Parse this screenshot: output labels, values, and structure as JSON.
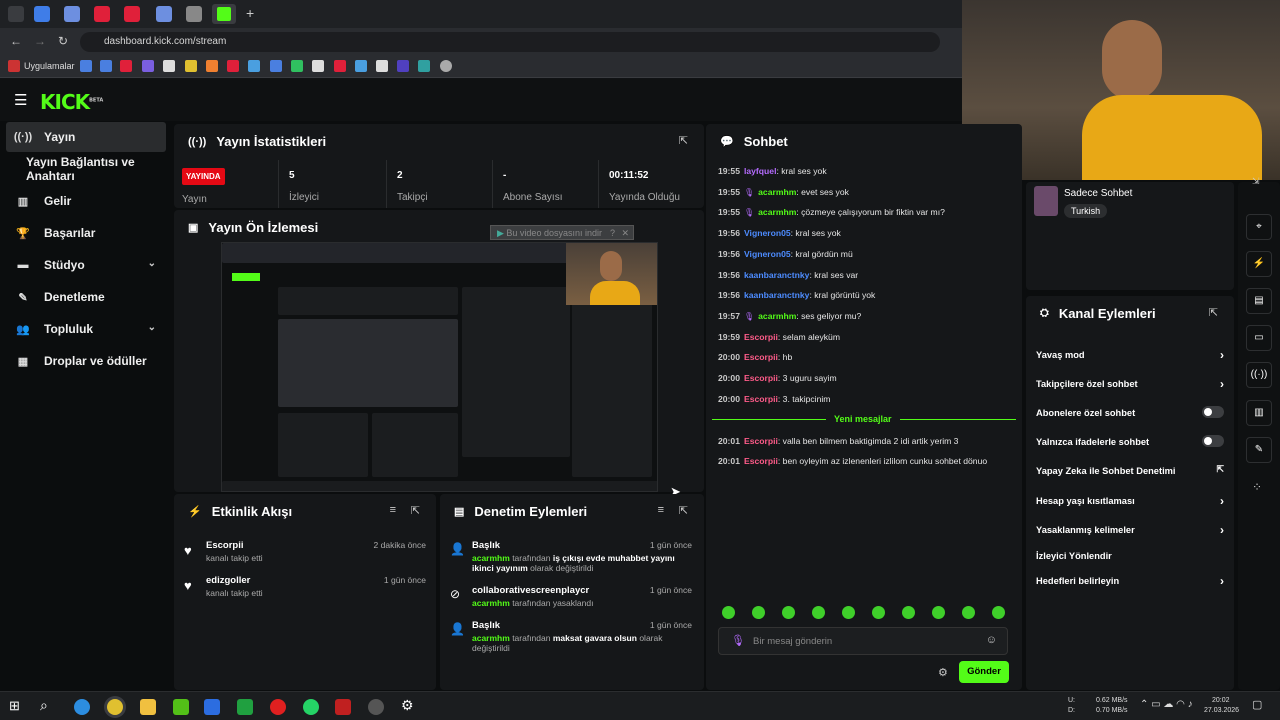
{
  "browser": {
    "url": "dashboard.kick.com/stream",
    "bookmarks_label": "Uygulamalar"
  },
  "app": {
    "logo": "KICK",
    "logo_badge": "BETA"
  },
  "sidebar": [
    {
      "label": "Yayın",
      "icon": "broadcast-icon",
      "active": true
    },
    {
      "label": "Yayın Bağlantısı ve Anahtarı",
      "icon": "",
      "active": false
    },
    {
      "label": "Gelir",
      "icon": "chart-icon",
      "active": false
    },
    {
      "label": "Başarılar",
      "icon": "trophy-icon",
      "active": false
    },
    {
      "label": "Stüdyo",
      "icon": "video-icon",
      "active": false,
      "expandable": true
    },
    {
      "label": "Denetleme",
      "icon": "wrench-icon",
      "active": false
    },
    {
      "label": "Topluluk",
      "icon": "people-icon",
      "active": false,
      "expandable": true
    },
    {
      "label": "Droplar ve ödüller",
      "icon": "gift-icon",
      "active": false
    }
  ],
  "stats": {
    "title": "Yayın İstatistikleri",
    "live_badge": "YAYINDA",
    "live_label": "Yayın",
    "items": [
      {
        "value": "5",
        "label": "İzleyici"
      },
      {
        "value": "2",
        "label": "Takipçi"
      },
      {
        "value": "-",
        "label": "Abone Sayısı"
      },
      {
        "value": "00:11:52",
        "label": "Yayında Olduğu"
      }
    ]
  },
  "preview": {
    "title": "Yayın Ön İzlemesi",
    "download": "Bu video dosyasını indir",
    "help": "?",
    "close": "✕"
  },
  "activity": {
    "title": "Etkinlik Akışı",
    "items": [
      {
        "name": "Escorpii",
        "text": "kanalı takip etti",
        "time": "2 dakika önce"
      },
      {
        "name": "edizgoller",
        "text": "kanalı takip etti",
        "time": "1 gün önce"
      }
    ]
  },
  "moderation": {
    "title": "Denetim Eylemleri",
    "items": [
      {
        "title": "Başlık",
        "user": "acarmhm",
        "mid": "tarafından",
        "bold": "iş çıkışı evde muhabbet yayını ikinci yayınım",
        "tail": "olarak değiştirildi",
        "time": "1 gün önce"
      },
      {
        "title": "collaborativescreenplaycr",
        "user": "acarmhm",
        "mid": "tarafından yasaklandı",
        "bold": "",
        "tail": "",
        "time": "1 gün önce"
      },
      {
        "title": "Başlık",
        "user": "acarmhm",
        "mid": "tarafından",
        "bold": "maksat gavara olsun",
        "tail": "olarak değiştirildi",
        "time": "1 gün önce"
      }
    ]
  },
  "chat": {
    "title": "Sohbet",
    "new_messages": "Yeni mesajlar",
    "placeholder": "Bir mesaj gönderin",
    "send": "Gönder",
    "messages": [
      {
        "time": "19:55",
        "user": "layfquel",
        "text": ": kral ses yok",
        "color": "#b56cff",
        "badge": false
      },
      {
        "time": "19:55",
        "user": "acarmhm",
        "text": ": evet ses yok",
        "color": "#53fc18",
        "badge": true
      },
      {
        "time": "19:55",
        "user": "acarmhm",
        "text": ": çözmeye çalışıyorum bir fiktin var mı?",
        "color": "#53fc18",
        "badge": true
      },
      {
        "time": "19:56",
        "user": "Vigneron05",
        "text": ": kral ses yok",
        "color": "#4d8cff",
        "badge": false
      },
      {
        "time": "19:56",
        "user": "Vigneron05",
        "text": ": kral gördün mü",
        "color": "#4d8cff",
        "badge": false
      },
      {
        "time": "19:56",
        "user": "kaanbaranctnky",
        "text": ": kral ses var",
        "color": "#4d8cff",
        "badge": false
      },
      {
        "time": "19:56",
        "user": "kaanbaranctnky",
        "text": ": kral görüntü yok",
        "color": "#4d8cff",
        "badge": false
      },
      {
        "time": "19:57",
        "user": "acarmhm",
        "text": ": ses geliyor mu?",
        "color": "#53fc18",
        "badge": true
      },
      {
        "time": "19:59",
        "user": "Escorpii",
        "text": ": selam aleyküm",
        "color": "#ff5c8a",
        "badge": false
      },
      {
        "time": "20:00",
        "user": "Escorpii",
        "text": ": hb",
        "color": "#ff5c8a",
        "badge": false
      },
      {
        "time": "20:00",
        "user": "Escorpii",
        "text": ": 3 uguru sayim",
        "color": "#ff5c8a",
        "badge": false
      },
      {
        "time": "20:00",
        "user": "Escorpii",
        "text": ": 3. takipcinim",
        "color": "#ff5c8a",
        "badge": false
      },
      {
        "time": "20:01",
        "user": "Escorpii",
        "text": ": valla ben bilmem baktigimda 2 idi artik yerim 3",
        "color": "#ff5c8a",
        "badge": false
      },
      {
        "time": "20:01",
        "user": "Escorpii",
        "text": ": ben oyleyim az izlenenleri izlilom cunku sohbet dönuo",
        "color": "#ff5c8a",
        "badge": false
      }
    ]
  },
  "channel": {
    "name": "Sadece Sohbet",
    "tag": "Turkish"
  },
  "channel_actions": {
    "title": "Kanal Eylemleri",
    "items": [
      {
        "label": "Yavaş mod",
        "type": "arrow"
      },
      {
        "label": "Takipçilere özel sohbet",
        "type": "arrow"
      },
      {
        "label": "Abonelere özel sohbet",
        "type": "toggle"
      },
      {
        "label": "Yalnızca ifadelerle sohbet",
        "type": "toggle"
      },
      {
        "label": "Yapay Zeka ile Sohbet Denetimi",
        "type": "external"
      },
      {
        "label": "Hesap yaşı kısıtlaması",
        "type": "arrow"
      },
      {
        "label": "Yasaklanmış kelimeler",
        "type": "arrow"
      },
      {
        "label": "İzleyici Yönlendir",
        "type": "none"
      },
      {
        "label": "Hedefleri belirleyin",
        "type": "arrow"
      }
    ]
  },
  "taskbar": {
    "net_up": "0.62 MB/s",
    "net_down": "0.70 MB/s",
    "up_label": "U:",
    "down_label": "D:",
    "time": "20:02",
    "date": "27.03.2026"
  },
  "colors": {
    "accent": "#53fc18",
    "live": "#e50914",
    "bg": "#0b0d0e",
    "panel": "#151719"
  }
}
